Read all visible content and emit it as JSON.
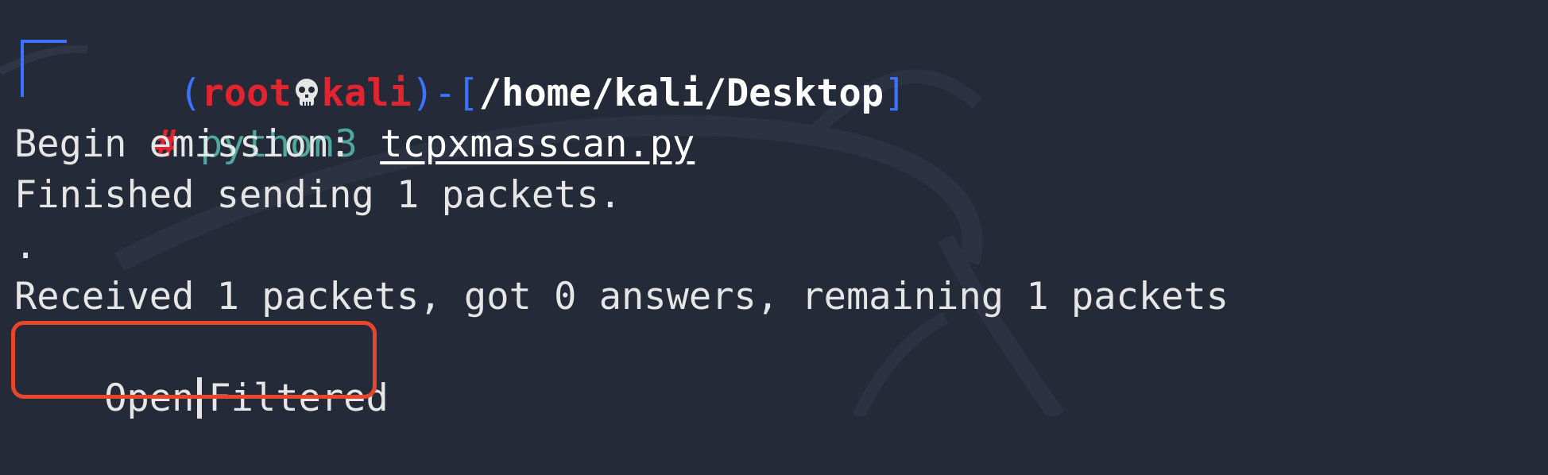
{
  "prompt": {
    "open_paren": "(",
    "user": "root",
    "host": "kali",
    "close_paren": ")",
    "dash_bracket_open": "-[",
    "path": "/home/kali/Desktop",
    "bracket_close": "]",
    "hash": "#",
    "command": "python3",
    "argument": "tcpxmasscan.py"
  },
  "output": {
    "line1": "Begin emission:",
    "line2": "Finished sending 1 packets.",
    "line3": ".",
    "line4": "Received 1 packets, got 0 answers, remaining 1 packets",
    "result_left": "Open",
    "result_right": "Filtered"
  },
  "colors": {
    "background": "#252a38",
    "prompt_frame": "#3a73ff",
    "user_host": "#e1242e",
    "command": "#4fa89d",
    "highlight": "#e8462c"
  }
}
